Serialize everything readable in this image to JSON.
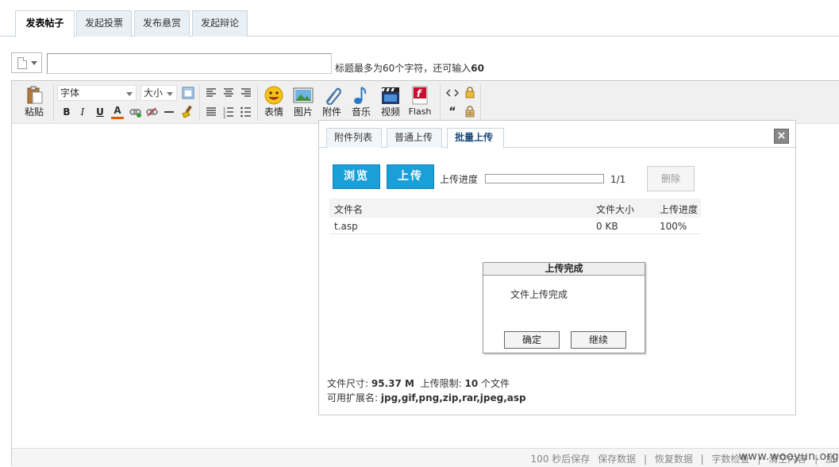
{
  "top_tabs": [
    {
      "label": "发表帖子",
      "active": true
    },
    {
      "label": "发起投票",
      "active": false
    },
    {
      "label": "发布悬赏",
      "active": false
    },
    {
      "label": "发起辩论",
      "active": false
    }
  ],
  "title_hint": {
    "prefix": "标题最多为60个字符，还可输入",
    "remaining": "60"
  },
  "toolbar": {
    "paste": "粘贴",
    "font": "字体",
    "size": "大小",
    "emoji": "表情",
    "image": "图片",
    "attachment": "附件",
    "music": "音乐",
    "video": "视频",
    "flash": "Flash",
    "bold": "B",
    "italic": "I",
    "underline": "U",
    "font_color": "A"
  },
  "upload_dialog": {
    "tabs": [
      {
        "label": "附件列表",
        "active": false
      },
      {
        "label": "普通上传",
        "active": false
      },
      {
        "label": "批量上传",
        "active": true
      }
    ],
    "close": "×",
    "browse_label": "浏览",
    "upload_label": "上传",
    "progress_label": "上传进度",
    "progress_count": "1/1",
    "delete_label": "删除",
    "table_headers": {
      "name": "文件名",
      "size": "文件大小",
      "progress": "上传进度"
    },
    "files": [
      {
        "name": "t.asp",
        "size": "0 KB",
        "progress": "100%"
      }
    ],
    "complete": {
      "title": "上传完成",
      "message": "文件上传完成",
      "ok_label": "确定",
      "continue_label": "继续"
    },
    "footer": {
      "size_prefix": "文件尺寸:",
      "size_value": "95.37 M",
      "limit_prefix": "上传限制:",
      "limit_value": "10",
      "limit_suffix": "个文件",
      "ext_prefix": "可用扩展名:",
      "ext_value": "jpg,gif,png,zip,rar,jpeg,asp"
    }
  },
  "status_bar": {
    "autosave": "100 秒后保存",
    "save": "保存数据",
    "sep": "|",
    "restore": "恢复数据",
    "wordcount": "字数检查",
    "clear": "清空内容",
    "more": "加"
  },
  "watermark": "www.wooyun.org",
  "colors": {
    "accent_blue": "#1a9fd8",
    "tab_bg": "#e8eff5",
    "border": "#c9d5de"
  }
}
